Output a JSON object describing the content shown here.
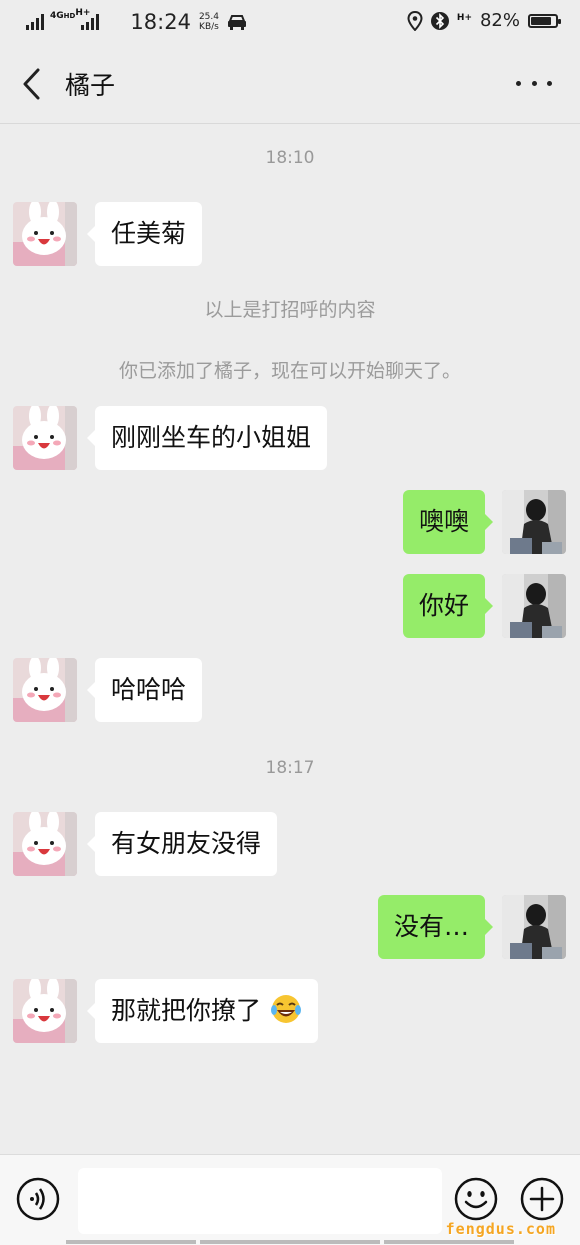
{
  "status_bar": {
    "net_4g": "4G",
    "net_hd": "HD",
    "net_h": "H+",
    "time": "18:24",
    "speed_value": "25.4",
    "speed_unit": "KB/s",
    "battery_pct": "82%",
    "battery_level": 0.82,
    "icons": [
      "signal-icon",
      "car-icon",
      "location-icon",
      "bluetooth-icon",
      "battery-icon"
    ]
  },
  "header": {
    "title": "橘子",
    "back_icon": "chevron-left-icon",
    "more_icon": "more-icon"
  },
  "messages": {
    "time1": "18:10",
    "greet": "任美菊",
    "sys1": "以上是打招呼的内容",
    "sys2": "你已添加了橘子，现在可以开始聊天了。",
    "m1": "刚刚坐车的小姐姐",
    "m2": "噢噢",
    "m3": "你好",
    "m4": "哈哈哈",
    "time2": "18:17",
    "m5": "有女朋友没得",
    "m6": "没有…",
    "m7": "那就把你撩了"
  },
  "input_bar": {
    "placeholder": "",
    "icons": [
      "voice-icon",
      "emoji-icon",
      "plus-icon"
    ]
  },
  "watermark": "fengdus.com",
  "colors": {
    "background": "#ededed",
    "bubble_out": "#95ec69",
    "bubble_in": "#ffffff",
    "system_text": "#9b9b9b"
  }
}
